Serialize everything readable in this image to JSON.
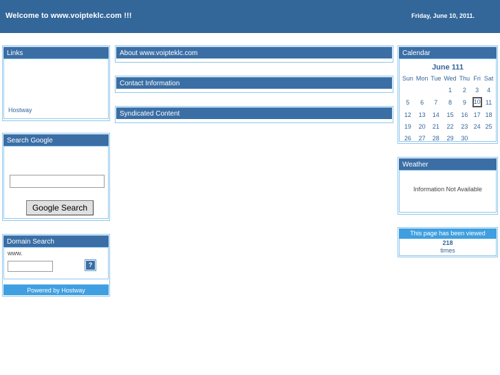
{
  "banner": {
    "title": "Welcome to www.voipteklc.com !!!",
    "date": "Friday, June 10, 2011."
  },
  "left_column": {
    "links": {
      "heading": "Links",
      "items": [
        {
          "label": "Hostway"
        }
      ]
    },
    "search_google": {
      "heading": "Search Google",
      "input_value": "",
      "input_placeholder": "",
      "button_label": "Google Search"
    },
    "domain_search": {
      "heading": "Domain Search",
      "prefix_label": "www.",
      "input_value": "",
      "input_placeholder": "",
      "help_button_label": "?",
      "footer_label": "Powered by Hostway"
    }
  },
  "middle_column": {
    "panels": [
      {
        "heading": "About www.voipteklc.com"
      },
      {
        "heading": "Contact Information"
      },
      {
        "heading": "Syndicated Content"
      }
    ]
  },
  "right_column": {
    "calendar": {
      "heading": "Calendar",
      "month_title": "June 111",
      "weekdays": [
        "Sun",
        "Mon",
        "Tue",
        "Wed",
        "Thu",
        "Fri",
        "Sat"
      ],
      "weeks": [
        [
          "",
          "",
          "",
          "1",
          "2",
          "3",
          "4"
        ],
        [
          "5",
          "6",
          "7",
          "8",
          "9",
          "10",
          "11"
        ],
        [
          "12",
          "13",
          "14",
          "15",
          "16",
          "17",
          "18"
        ],
        [
          "19",
          "20",
          "21",
          "22",
          "23",
          "24",
          "25"
        ],
        [
          "26",
          "27",
          "28",
          "29",
          "30",
          "",
          ""
        ]
      ],
      "today": "10"
    },
    "weather": {
      "heading": "Weather",
      "message": "Information Not Available"
    },
    "counter": {
      "heading": "This page has been viewed",
      "value": "218",
      "label": "times"
    }
  },
  "colors": {
    "banner_blue": "#336699",
    "panel_header_blue": "#3a6ea5",
    "panel_border_blue": "#8ec6ec",
    "accent_light_blue": "#3f9fe0",
    "link_blue": "#336699"
  }
}
